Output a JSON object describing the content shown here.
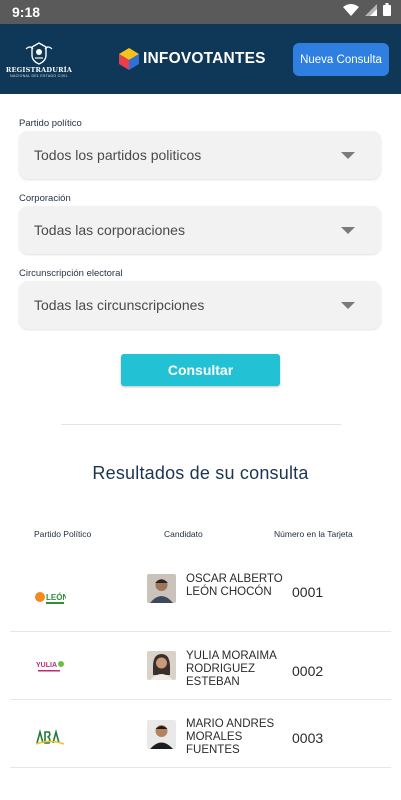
{
  "status_bar": {
    "time": "9:18"
  },
  "header": {
    "registry_logo_text": "REGISTRADURÍA",
    "registry_logo_subtext": "NACIONAL DEL ESTADO CIVIL",
    "brand_name": "INFOVOTANTES",
    "new_query_button": "Nueva Consulta",
    "colors": {
      "header_bg": "#0e3758",
      "button_bg": "#2f7fe0"
    }
  },
  "filters": [
    {
      "label": "Partido político",
      "value": "Todos los partidos politicos"
    },
    {
      "label": "Corporación",
      "value": "Todas las corporaciones"
    },
    {
      "label": "Circunscripción electoral",
      "value": "Todas las circunscripciones"
    }
  ],
  "consult_button": {
    "label": "Consultar",
    "color": "#22c1d4"
  },
  "results": {
    "title": "Resultados de su consulta",
    "columns": [
      "Partido Político",
      "Candidato",
      "Número en la Tarjeta"
    ],
    "rows": [
      {
        "party_logo_text": "LEÓN",
        "candidate": "OSCAR ALBERTO LEÓN CHOCÓN",
        "number": "0001"
      },
      {
        "party_logo_text": "YULIA",
        "candidate": "YULIA MORAIMA RODRIGUEZ ESTEBAN",
        "number": "0002"
      },
      {
        "party_logo_text": "",
        "candidate": "MARIO ANDRES MORALES FUENTES",
        "number": "0003"
      }
    ]
  }
}
